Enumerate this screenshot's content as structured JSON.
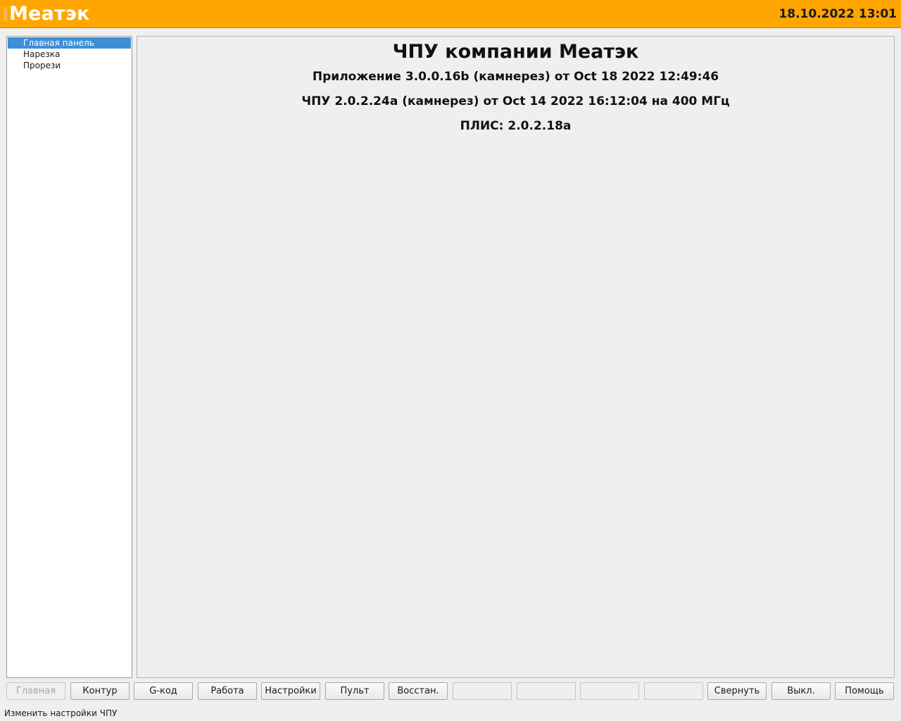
{
  "header": {
    "app_title": "Меатэк",
    "datetime": "18.10.2022 13:01"
  },
  "sidebar": {
    "items": [
      {
        "label": "Главная панель",
        "selected": true
      },
      {
        "label": "Нарезка",
        "selected": false
      },
      {
        "label": "Прорези",
        "selected": false
      }
    ]
  },
  "main": {
    "heading": "ЧПУ компании Меатэк",
    "app_version": "Приложение 3.0.0.16b (камнерез) от Oct 18 2022 12:49:46",
    "cnc_version": "ЧПУ 2.0.2.24a (камнерез) от Oct 14 2022 16:12:04 на 400 МГц",
    "fpga_version": "ПЛИС: 2.0.2.18a"
  },
  "buttons": [
    {
      "label": "Главная",
      "state": "disabled"
    },
    {
      "label": "Контур",
      "state": "normal"
    },
    {
      "label": "G-код",
      "state": "normal"
    },
    {
      "label": "Работа",
      "state": "normal"
    },
    {
      "label": "Настройки",
      "state": "normal"
    },
    {
      "label": "Пульт",
      "state": "normal"
    },
    {
      "label": "Восстан.",
      "state": "normal"
    },
    {
      "label": "",
      "state": "empty"
    },
    {
      "label": "",
      "state": "empty"
    },
    {
      "label": "",
      "state": "empty"
    },
    {
      "label": "",
      "state": "empty"
    },
    {
      "label": "Свернуть",
      "state": "normal"
    },
    {
      "label": "Выкл.",
      "state": "normal"
    },
    {
      "label": "Помощь",
      "state": "normal"
    }
  ],
  "status": {
    "text": "Изменить настройки ЧПУ"
  },
  "colors": {
    "header_bg": "#ffa500",
    "selection": "#3d8fd6"
  }
}
